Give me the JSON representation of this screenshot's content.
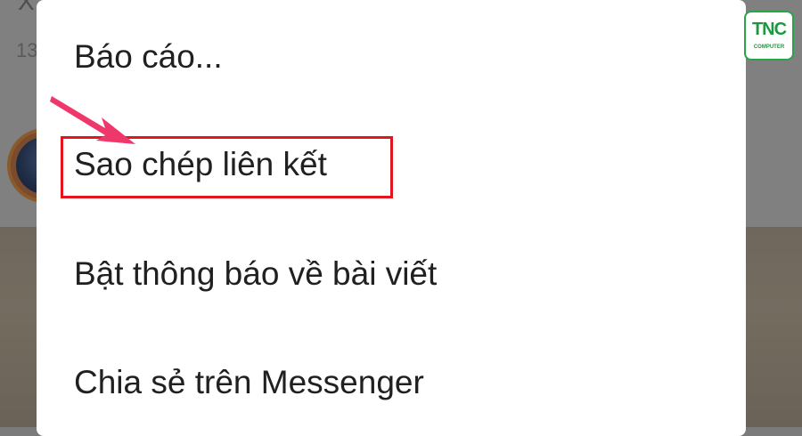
{
  "background": {
    "title_partial": "X",
    "meta_partial": "13"
  },
  "menu": {
    "items": [
      {
        "label": "Báo cáo..."
      },
      {
        "label": "Sao chép liên kết"
      },
      {
        "label": "Bật thông báo về bài viết"
      },
      {
        "label": "Chia sẻ trên Messenger"
      }
    ]
  },
  "annotation": {
    "highlighted_item": "Sao chép liên kết",
    "highlight_color": "#e3151f",
    "arrow_color": "#f0376b"
  },
  "logo": {
    "text": "TNC",
    "subtext": "COMPUTER",
    "color": "#1a9a3e"
  }
}
